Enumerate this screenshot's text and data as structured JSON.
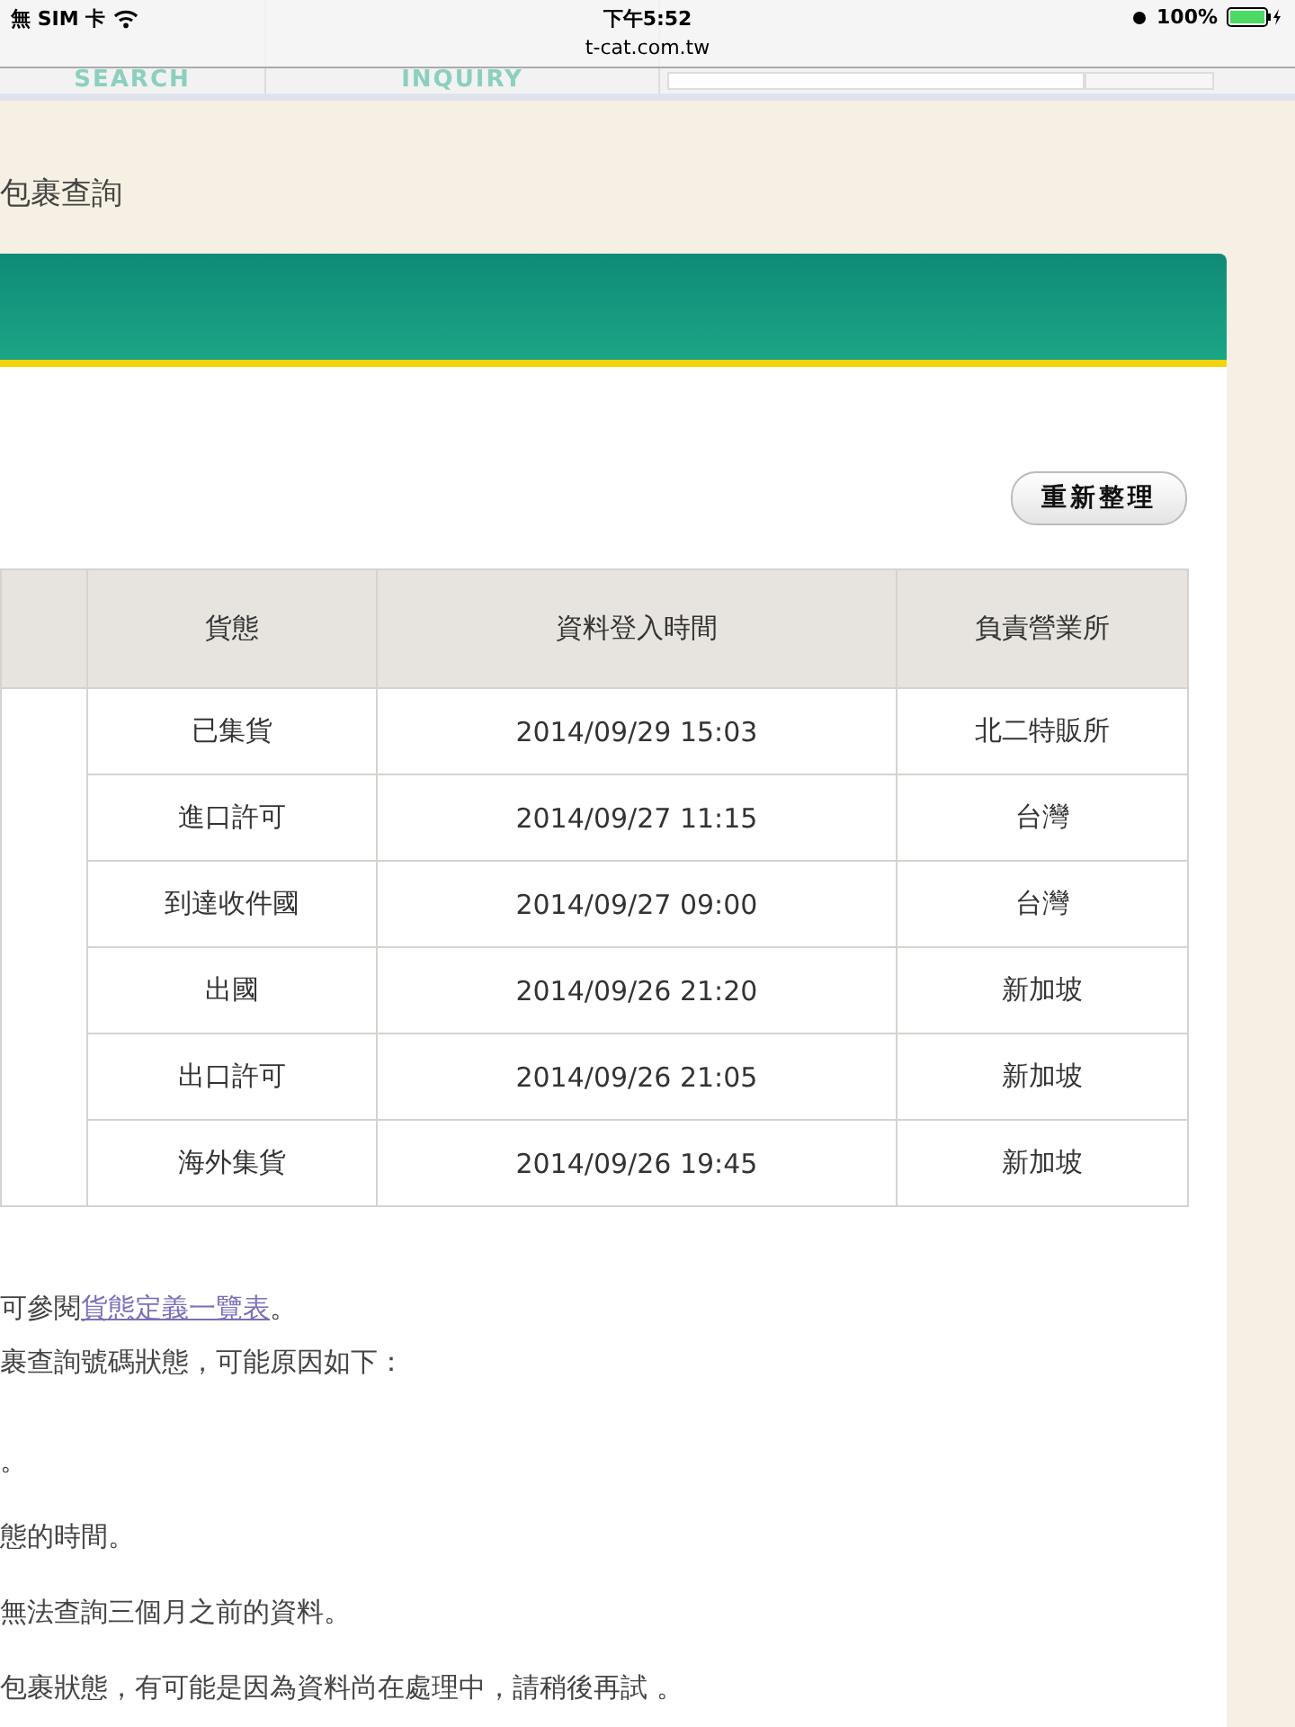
{
  "status_bar": {
    "carrier": "無 SIM 卡",
    "time": "下午5:52",
    "url": "t-cat.com.tw",
    "battery": "100%"
  },
  "nav": {
    "tabs": [
      {
        "subtitle": "SEARCH"
      },
      {
        "subtitle": "INQUIRY"
      }
    ]
  },
  "page_title": "包裹查詢",
  "refresh_button": "重新整理",
  "table": {
    "columns": [
      "貨態",
      "資料登入時間",
      "負責營業所"
    ],
    "rows": [
      [
        "已集貨",
        "2014/09/29 15:03",
        "北二特販所"
      ],
      [
        "進口許可",
        "2014/09/27 11:15",
        "台灣"
      ],
      [
        "到達收件國",
        "2014/09/27 09:00",
        "台灣"
      ],
      [
        "出國",
        "2014/09/26 21:20",
        "新加坡"
      ],
      [
        "出口許可",
        "2014/09/26 21:05",
        "新加坡"
      ],
      [
        "海外集貨",
        "2014/09/26 19:45",
        "新加坡"
      ]
    ]
  },
  "notes": [
    {
      "text": "可參閱",
      "link": "貨態定義一覽表",
      "after": "。"
    },
    {
      "text": "裹查詢號碼狀態，可能原因如下："
    },
    {
      "text": "。"
    },
    {
      "text": "態的時間。"
    },
    {
      "text": "無法查詢三個月之前的資料。"
    },
    {
      "text": "包裹狀態，有可能是因為資料尚在處理中，請稍後再試 。"
    }
  ]
}
